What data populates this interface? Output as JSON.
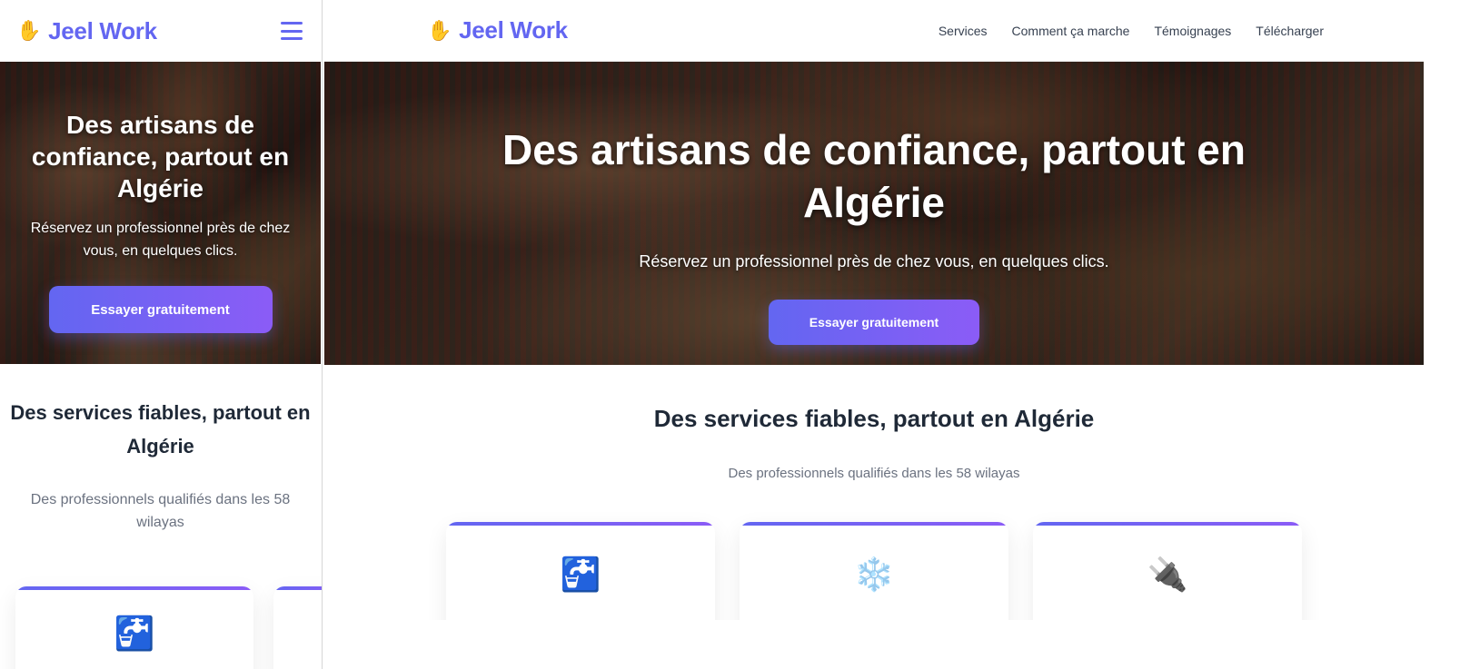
{
  "brand": {
    "name": "Jeel Work",
    "logo_icon": "hand-logo-icon",
    "accent": "#6366f1",
    "accent_2": "#8b5cf6"
  },
  "nav": {
    "items": [
      {
        "label": "Services"
      },
      {
        "label": "Comment ça marche"
      },
      {
        "label": "Témoignages"
      },
      {
        "label": "Télécharger"
      }
    ],
    "menu_icon": "hamburger-menu-icon"
  },
  "hero": {
    "title": "Des artisans de confiance, partout en Algérie",
    "subtitle": "Réservez un professionnel près de chez vous, en quelques clics.",
    "cta_label": "Essayer gratuitement"
  },
  "services": {
    "title": "Des services fiables, partout en Algérie",
    "subtitle": "Des professionnels qualifiés dans les 58 wilayas",
    "cards": [
      {
        "icon": "faucet-icon",
        "glyph": "🚰"
      },
      {
        "icon": "snowflake-icon",
        "glyph": "❄️"
      },
      {
        "icon": "electric-plug-icon",
        "glyph": "🔌"
      }
    ]
  }
}
